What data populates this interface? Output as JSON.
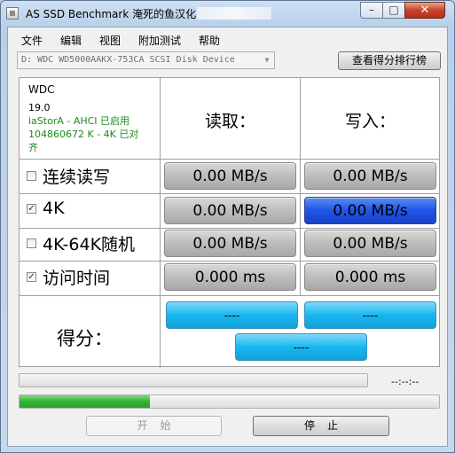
{
  "window": {
    "title": "AS SSD Benchmark 淹死的鱼汉化"
  },
  "menu": [
    "文件",
    "编辑",
    "视图",
    "附加测试",
    "帮助"
  ],
  "drive_select": {
    "value": "D: WDC WD5000AAKX-753CA SCSI Disk Device"
  },
  "rank_button": "查看得分排行榜",
  "drive_info": {
    "name": "WDC",
    "version": "19.0",
    "driver": "iaStorA - AHCI 已启用",
    "alignment": "104860672 K - 4K 已对",
    "alignment_cont": "齐"
  },
  "columns": {
    "read": "读取：",
    "write": "写入："
  },
  "tests": [
    {
      "label": "连续读写",
      "checked": false,
      "read": "0.00 MB/s",
      "write": "0.00 MB/s",
      "write_active": false
    },
    {
      "label": "4K",
      "checked": true,
      "read": "0.00 MB/s",
      "write": "0.00 MB/s",
      "write_active": true
    },
    {
      "label": "4K-64K随机",
      "checked": false,
      "read": "0.00 MB/s",
      "write": "0.00 MB/s",
      "write_active": false
    },
    {
      "label": "访问时间",
      "checked": true,
      "read": "0.000 ms",
      "write": "0.000 ms",
      "write_active": false
    }
  ],
  "score": {
    "label": "得分：",
    "read": "----",
    "write": "----",
    "total": "----"
  },
  "progress": {
    "overall": 0,
    "current": 0.31,
    "elapsed": "--:--:--"
  },
  "buttons": {
    "start": "开始",
    "stop": "停止"
  },
  "colors": {
    "score_fill": "#18b6ef",
    "active_cell": "#1f54e8",
    "progress_fill": "#31b431"
  }
}
